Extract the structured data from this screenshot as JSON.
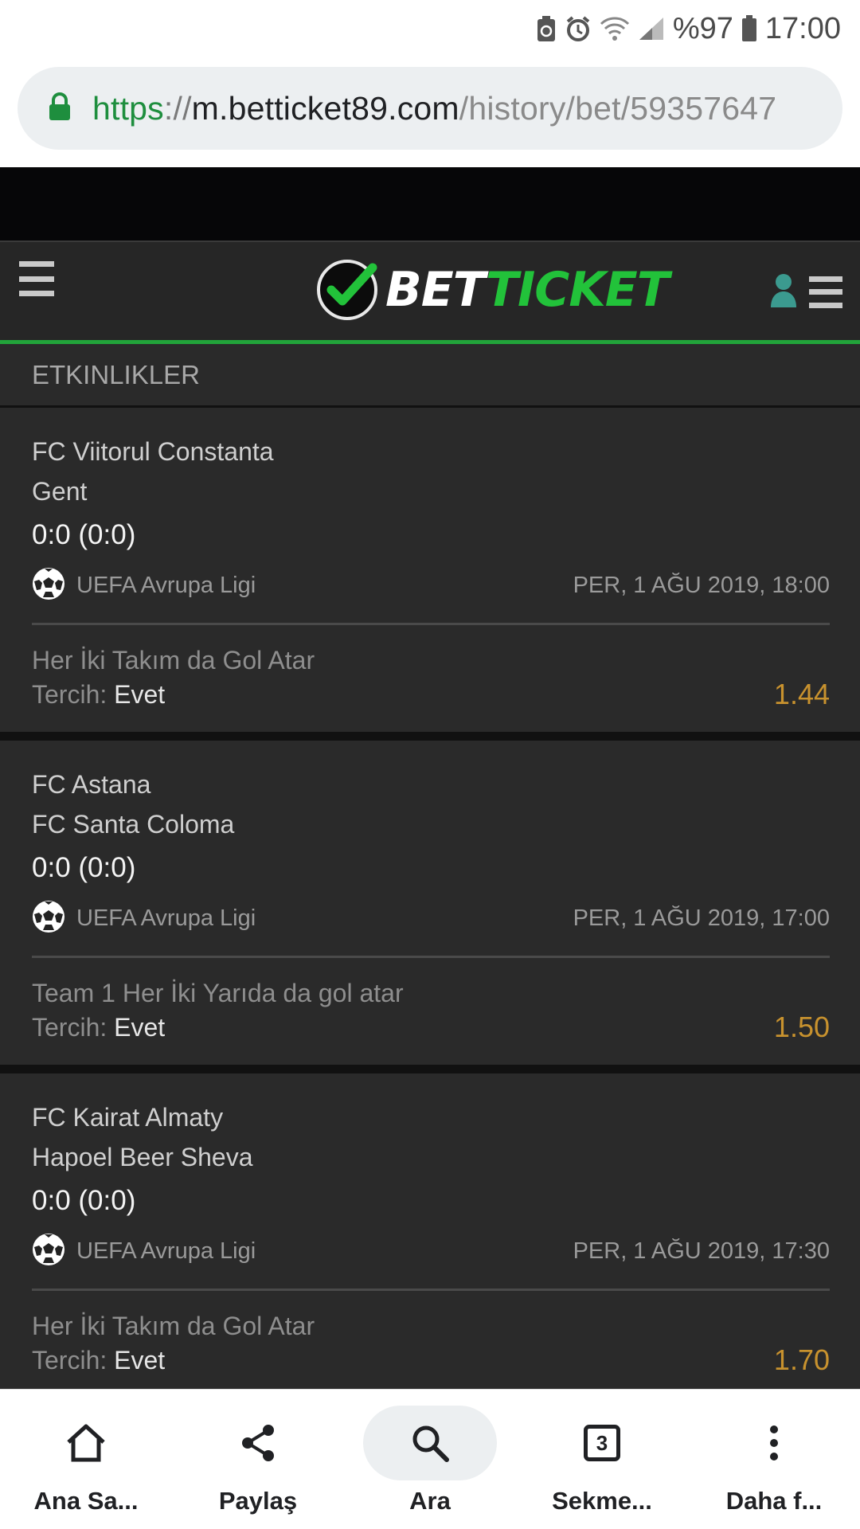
{
  "status_bar": {
    "battery": "%97",
    "time": "17:00"
  },
  "address_bar": {
    "scheme": "https",
    "separator": "://",
    "host": "m.betticket89.com",
    "path": "/history/bet/59357647"
  },
  "header": {
    "logo_bet": "BET",
    "logo_ticket": "TICKET"
  },
  "section": {
    "title": "ETKINLIKLER"
  },
  "events": [
    {
      "home": "FC Viitorul Constanta",
      "away": "Gent",
      "score": "0:0 (0:0)",
      "league": "UEFA Avrupa Ligi",
      "date": "PER, 1 AĞU 2019, 18:00",
      "market": "Her İki Takım da Gol Atar",
      "pick_label": "Tercih:",
      "pick_value": "Evet",
      "odds": "1.44"
    },
    {
      "home": "FC Astana",
      "away": "FC Santa Coloma",
      "score": "0:0 (0:0)",
      "league": "UEFA Avrupa Ligi",
      "date": "PER, 1 AĞU 2019, 17:00",
      "market": "Team 1 Her İki Yarıda da gol atar",
      "pick_label": "Tercih:",
      "pick_value": "Evet",
      "odds": "1.50"
    },
    {
      "home": "FC Kairat Almaty",
      "away": "Hapoel Beer Sheva",
      "score": "0:0 (0:0)",
      "league": "UEFA Avrupa Ligi",
      "date": "PER, 1 AĞU 2019, 17:30",
      "market": "Her İki Takım da Gol Atar",
      "pick_label": "Tercih:",
      "pick_value": "Evet",
      "odds": "1.70"
    }
  ],
  "bottom_nav": {
    "home": "Ana Sa...",
    "share": "Paylaş",
    "search": "Ara",
    "tabs": "Sekme...",
    "tabs_count": "3",
    "more": "Daha f..."
  },
  "colors": {
    "accent_green": "#22a33a",
    "odds_gold": "#c8922e",
    "panel_bg": "#2a2a2a"
  }
}
